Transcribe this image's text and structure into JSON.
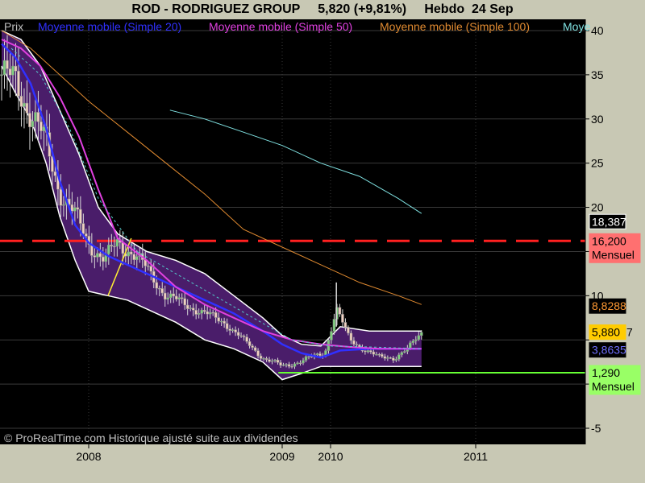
{
  "header": {
    "symbol": "ROD - RODRIGUEZ GROUP",
    "price_change": "5,820 (+9,81%)",
    "period": "Hebdo  24 Sep"
  },
  "legend": {
    "prix": "Prix",
    "items": [
      {
        "label": "Moyenne mobile (Simple 20)",
        "color": "#3030ff"
      },
      {
        "label": "Moyenne mobile (Simple 50)",
        "color": "#e040e0"
      },
      {
        "label": "Moyenne mobile (Simple 100)",
        "color": "#e08a30"
      },
      {
        "label": "Moye",
        "color": "#7fe0e0"
      }
    ]
  },
  "footer": {
    "credit": "© ProRealTime.com Historique ajusté suite aux dividendes"
  },
  "price_tags": [
    {
      "text": "18,387",
      "value": 18.387,
      "bg": "#000000",
      "fg": "#ffffff",
      "border": "#ffffff"
    },
    {
      "text": "16,200",
      "sub": "Mensuel",
      "value": 16.2,
      "bg": "#ff7070",
      "fg": "#000000",
      "border": "#ff7070"
    },
    {
      "text": "8,8288",
      "value": 8.8288,
      "bg": "#000000",
      "fg": "#ff9933",
      "border": "#000000"
    },
    {
      "text": "5,880",
      "extra": "7",
      "value": 5.88,
      "bg": "#ffcc00",
      "fg": "#000000",
      "border": "#ffcc00"
    },
    {
      "text": "3,8635",
      "value": 3.8635,
      "bg": "#000000",
      "fg": "#7070ff",
      "border": "#000000"
    },
    {
      "text": "1,290",
      "sub": "Mensuel",
      "value": 1.29,
      "bg": "#99ff66",
      "fg": "#000000",
      "border": "#99ff66"
    }
  ],
  "chart_data": {
    "type": "line",
    "title": "ROD - RODRIGUEZ GROUP",
    "y_ticks": [
      40,
      35,
      30,
      25,
      20,
      15,
      10,
      5,
      0,
      -5
    ],
    "y_tick_labels": [
      "40",
      "35",
      "30",
      "25",
      "20",
      "",
      "10",
      "",
      "",
      "-5"
    ],
    "ylim": [
      -5,
      40
    ],
    "x_ticks": [
      {
        "label": "2008",
        "t": 2008.0
      },
      {
        "label": "2009",
        "t": 2009.0
      },
      {
        "label": "2010",
        "t": 2009.25
      },
      {
        "label": "2011",
        "t": 2010.0
      }
    ],
    "xlim": [
      2007.55,
      2010.55
    ],
    "grid": true,
    "horizontal_lines": [
      {
        "name": "Mensuel",
        "value": 16.2,
        "color": "#ff2020",
        "style": "dashed"
      },
      {
        "name": "Mensuel",
        "value": 1.29,
        "color": "#66ff33",
        "style": "solid"
      }
    ],
    "price": {
      "t": [
        2007.55,
        2007.62,
        2007.7,
        2007.78,
        2007.85,
        2007.93,
        2008.0,
        2008.08,
        2008.15,
        2008.22,
        2008.3,
        2008.4,
        2008.5,
        2008.6,
        2008.7,
        2008.8,
        2008.9,
        2009.0,
        2009.08,
        2009.15,
        2009.22,
        2009.28,
        2009.35,
        2009.42,
        2009.5,
        2009.58,
        2009.65,
        2009.72
      ],
      "close": [
        35,
        34,
        31,
        27,
        22,
        19,
        16,
        14,
        16,
        15,
        13,
        10,
        9,
        8,
        7,
        5,
        3,
        2,
        2.5,
        3,
        3.5,
        8.5,
        5,
        4,
        3,
        3,
        4,
        5.8
      ]
    },
    "series": [
      {
        "name": "Moyenne mobile (Simple 20)",
        "color": "#3030ff",
        "t": [
          2007.55,
          2007.62,
          2007.7,
          2007.78,
          2007.85,
          2007.93,
          2008.0,
          2008.1,
          2008.2,
          2008.3,
          2008.45,
          2008.6,
          2008.75,
          2008.9,
          2009.0,
          2009.1,
          2009.2,
          2009.3,
          2009.45,
          2009.6,
          2009.72
        ],
        "values": [
          38.5,
          37,
          34,
          29,
          23,
          18,
          16,
          14.5,
          13.5,
          12.5,
          11,
          9.5,
          8,
          6,
          4.5,
          3.5,
          3,
          3.8,
          4,
          4,
          4
        ]
      },
      {
        "name": "Moyenne mobile (Simple 50)",
        "color": "#e040e0",
        "t": [
          2007.55,
          2007.65,
          2007.75,
          2007.85,
          2007.95,
          2008.05,
          2008.15,
          2008.3,
          2008.45,
          2008.6,
          2008.75,
          2008.9,
          2009.05,
          2009.2,
          2009.35,
          2009.5,
          2009.72
        ],
        "values": [
          39,
          38,
          36,
          32.5,
          28,
          22,
          16.5,
          14,
          11,
          9,
          7.5,
          6,
          5,
          4.5,
          4.2,
          4,
          4
        ]
      },
      {
        "name": "Moyenne mobile (Simple 100)",
        "color": "#e08a30",
        "t": [
          2007.55,
          2007.7,
          2007.85,
          2008.0,
          2008.2,
          2008.4,
          2008.6,
          2008.8,
          2009.0,
          2009.2,
          2009.4,
          2009.6,
          2009.72
        ],
        "values": [
          40,
          38,
          35,
          32,
          28.5,
          25,
          21.5,
          17.5,
          15.5,
          13.5,
          11.5,
          10,
          9
        ]
      },
      {
        "name": "Moye",
        "color": "#7fe0e0",
        "t": [
          2008.42,
          2008.6,
          2008.8,
          2009.0,
          2009.2,
          2009.4,
          2009.6,
          2009.72
        ],
        "values": [
          31,
          30,
          28.5,
          27,
          25,
          23.5,
          21,
          19.3
        ]
      }
    ],
    "bollinger": {
      "upper": {
        "t": [
          2007.55,
          2007.65,
          2007.75,
          2007.85,
          2007.95,
          2008.05,
          2008.15,
          2008.3,
          2008.45,
          2008.6,
          2008.75,
          2008.9,
          2009.0,
          2009.1,
          2009.2,
          2009.3,
          2009.45,
          2009.6,
          2009.72
        ],
        "values": [
          40,
          39,
          36,
          31,
          26,
          20,
          17,
          15,
          14,
          12.5,
          10,
          7.5,
          5.5,
          4.5,
          4.3,
          6.5,
          6,
          6,
          6
        ]
      },
      "lower": {
        "t": [
          2007.55,
          2007.62,
          2007.7,
          2007.78,
          2007.85,
          2007.93,
          2008.0,
          2008.1,
          2008.2,
          2008.3,
          2008.45,
          2008.6,
          2008.75,
          2008.9,
          2009.0,
          2009.1,
          2009.2,
          2009.3,
          2009.45,
          2009.6,
          2009.72
        ],
        "values": [
          36,
          33,
          30,
          25,
          19,
          14,
          10.5,
          10,
          9.5,
          8.5,
          7,
          5,
          4,
          2.5,
          0.5,
          1.2,
          2,
          2,
          2,
          2,
          2
        ]
      }
    }
  }
}
